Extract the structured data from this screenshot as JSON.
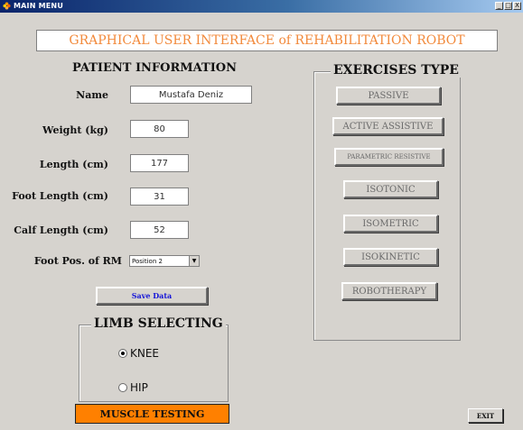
{
  "window": {
    "title": "MAIN MENU",
    "app_icon": "flower-icon",
    "controls": [
      "_",
      "□",
      "X"
    ]
  },
  "header": {
    "title": "GRAPHICAL USER INTERFACE of REHABILITATION ROBOT",
    "title_color": "#f28a3c"
  },
  "patient": {
    "section_title": "PATIENT INFORMATION",
    "name_label": "Name",
    "name_value": "Mustafa Deniz",
    "weight_label": "Weight (kg)",
    "weight_value": "80",
    "length_label": "Length (cm)",
    "length_value": "177",
    "foot_length_label": "Foot Length (cm)",
    "foot_length_value": "31",
    "calf_length_label": "Calf Length (cm)",
    "calf_length_value": "52",
    "foot_pos_label": "Foot Pos. of RM",
    "foot_pos_value": "Position 2",
    "save_label": "Save Data"
  },
  "limb": {
    "title": "LIMB SELECTING",
    "options": [
      {
        "label": "KNEE",
        "checked": true
      },
      {
        "label": "HIP",
        "checked": false
      }
    ]
  },
  "exercises": {
    "title": "EXERCISES TYPE",
    "buttons": [
      "PASSIVE",
      "ACTIVE ASSISTIVE",
      "PARAMETRIC RESISTIVE",
      "ISOTONIC",
      "ISOMETRIC",
      "ISOKINETIC",
      "ROBOTHERAPY"
    ]
  },
  "actions": {
    "muscle_testing_label": "MUSCLE TESTING",
    "muscle_testing_color": "#ff8000",
    "exit_label": "EXIT"
  }
}
